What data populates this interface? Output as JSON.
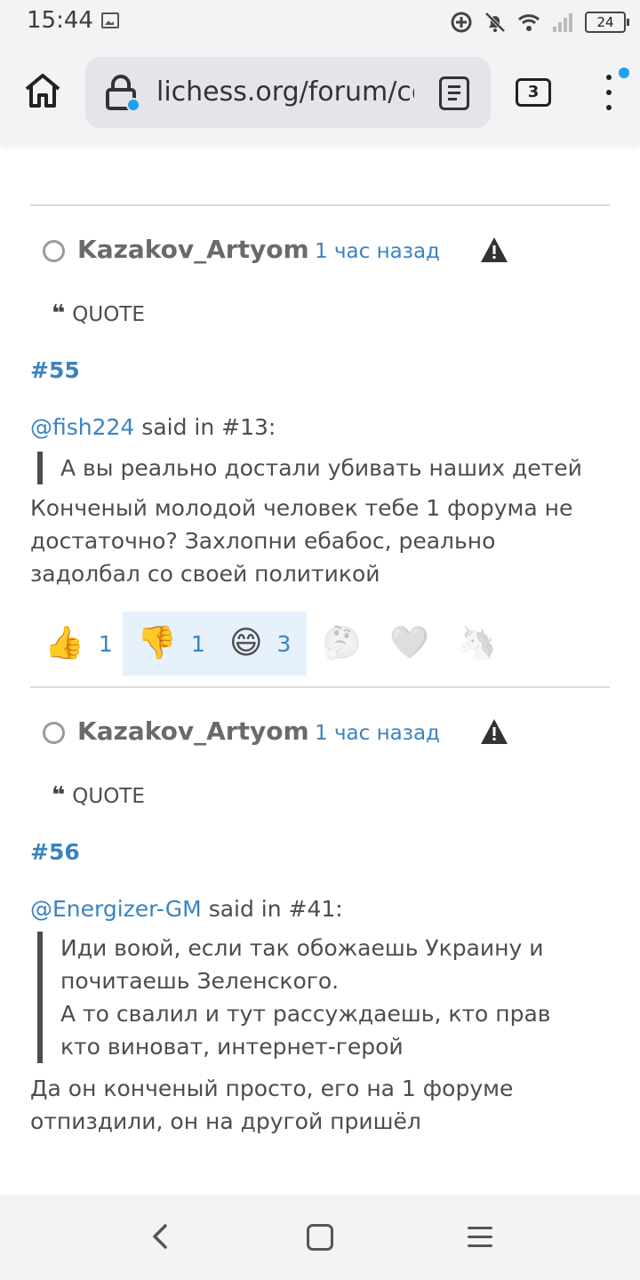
{
  "status_bar": {
    "time": "15:44",
    "battery": "24",
    "icons": [
      "image-icon",
      "data-saver-icon",
      "mute-icon",
      "wifi-icon",
      "signal-icon",
      "battery-icon"
    ]
  },
  "browser": {
    "url": "lichess.org/forum/con",
    "tab_count": "3"
  },
  "posts": [
    {
      "author": "Kazakov_Artyom",
      "time": "1 час назад",
      "quote_label": "QUOTE",
      "number": "#55",
      "mention": "@fish224",
      "said_in": " said in #13:",
      "quoted_lines": [
        "А вы реально достали убивать наших детей"
      ],
      "body": "Конченый молодой человек тебе 1 форума не достаточно? Захлопни ебабос, реально задолбал со своей политикой",
      "reactions": [
        {
          "icon": "thumbs-up-icon",
          "emoji": "👍",
          "count": "1"
        },
        {
          "icon": "thumbs-down-icon",
          "emoji": "👎",
          "count": "1"
        },
        {
          "icon": "laughing-icon",
          "emoji": "😄",
          "count": "3"
        },
        {
          "icon": "thinking-icon",
          "emoji": "🤔",
          "count": ""
        },
        {
          "icon": "heart-icon",
          "emoji": "🩶",
          "count": ""
        },
        {
          "icon": "horse-icon",
          "emoji": "🦄",
          "count": ""
        }
      ]
    },
    {
      "author": "Kazakov_Artyom",
      "time": "1 час назад",
      "quote_label": "QUOTE",
      "number": "#56",
      "mention": "@Energizer-GM",
      "said_in": " said in #41:",
      "quoted_lines": [
        "Иди воюй, если так обожаешь Украину и почитаешь Зеленского.",
        "А то свалил и тут рассуждаешь, кто прав кто виноват, интернет-герой"
      ],
      "body": "Да он конченый просто, его на 1 форуме отпиздили, он на другой пришёл"
    }
  ],
  "colors": {
    "link": "#3a83c3",
    "text": "#4d4d4d",
    "highlight": "#e6f1fb",
    "chrome": "#f1f3f4"
  }
}
